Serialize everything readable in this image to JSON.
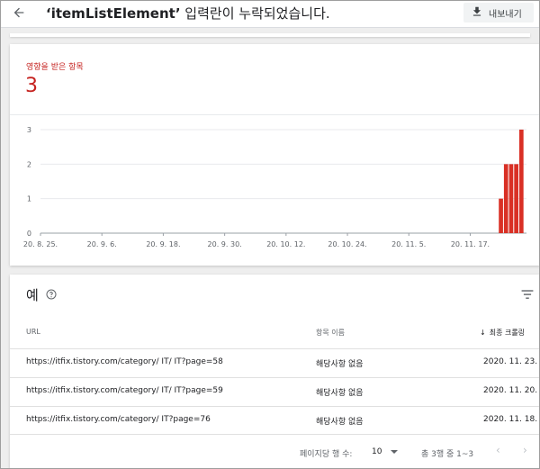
{
  "header": {
    "title_quoted": "‘itemListElement’",
    "title_rest": " 입력란이 누락되었습니다.",
    "export_label": "내보내기",
    "back_icon": "arrow-left-icon",
    "export_icon": "download-icon"
  },
  "summary": {
    "label": "영향을 받은 항목",
    "value": "3",
    "accent_color": "#c5221f"
  },
  "chart_data": {
    "type": "bar",
    "y_ticks": [
      "0",
      "1",
      "2",
      "3"
    ],
    "ylim": [
      0,
      3
    ],
    "x_tick_labels": [
      "20. 8. 25.",
      "20. 9. 6.",
      "20. 9. 18.",
      "20. 9. 30.",
      "20. 10. 12.",
      "20. 10. 24.",
      "20. 11. 5.",
      "20. 11. 17."
    ],
    "x_range_days": [
      0,
      95
    ],
    "x_tick_days": [
      0,
      12,
      24,
      36,
      48,
      60,
      72,
      84
    ],
    "bars": [
      {
        "day": 90,
        "value": 1
      },
      {
        "day": 91,
        "value": 2
      },
      {
        "day": 92,
        "value": 2
      },
      {
        "day": 93,
        "value": 2
      },
      {
        "day": 94,
        "value": 3
      }
    ],
    "bar_color": "#d93025",
    "grid": true
  },
  "examples": {
    "title": "예",
    "help_icon": "help-circle-icon",
    "filter_icon": "filter-icon",
    "columns": {
      "url": "URL",
      "name": "항목 이름",
      "date": "최종 크롤링"
    },
    "rows": [
      {
        "url": "https://itfix.tistory.com/category/ IT/ IT?page=58",
        "name": "해당사항 없음",
        "date": "2020. 11. 23."
      },
      {
        "url": "https://itfix.tistory.com/category/ IT/ IT?page=59",
        "name": "해당사항 없음",
        "date": "2020. 11. 20."
      },
      {
        "url": "https://itfix.tistory.com/category/ IT?page=76",
        "name": "해당사항 없음",
        "date": "2020. 11. 18."
      }
    ]
  },
  "pagination": {
    "rows_per_page_label": "페이지당 행 수:",
    "rows_per_page": "10",
    "range_label": "총 3행 중 1~3",
    "prev": "‹",
    "next": "›"
  }
}
